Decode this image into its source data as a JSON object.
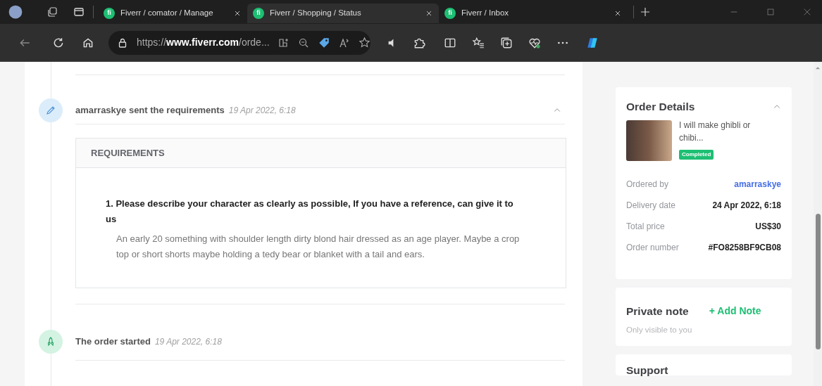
{
  "browser": {
    "tabs": [
      {
        "logo": "fi",
        "title": "Fiverr / comator / Manage",
        "selected": false
      },
      {
        "logo": "fi",
        "title": "Fiverr / Shopping / Status",
        "selected": true
      },
      {
        "logo": "fi",
        "title": "Fiverr / Inbox",
        "selected": false
      }
    ],
    "address": "https://**www.fiverr.com**/orde..."
  },
  "timeline": [
    {
      "kind": "requirements",
      "title": "amarraskye sent the requirements",
      "time": "19 Apr 2022, 6:18",
      "expanded": true,
      "panel": {
        "title": "REQUIREMENTS",
        "items": [
          {
            "question": "1. Please describe your character as clearly as possible, If you have a reference, can give it to us",
            "answer": "An early 20 something with shoulder length dirty blond hair dressed as an age player. Maybe a crop top or short shorts maybe holding a tedy bear or blanket with a tail and ears."
          }
        ]
      }
    },
    {
      "kind": "started",
      "title": "The order started",
      "time": "19 Apr 2022, 6:18"
    }
  ],
  "sidebar": {
    "order_details": {
      "title": "Order Details",
      "expanded": true,
      "gig_title": "I will make ghibli or chibi...",
      "status": "Completed",
      "rows": [
        {
          "label": "Ordered by",
          "value": "amarraskye",
          "kind": "link"
        },
        {
          "label": "Delivery date",
          "value": "24 Apr 2022, 6:18",
          "kind": "text"
        },
        {
          "label": "Total price",
          "value": "US$30",
          "kind": "text"
        },
        {
          "label": "Order number",
          "value": "#FO8258BF9CB08",
          "kind": "text"
        }
      ]
    },
    "private_note": {
      "title": "Private note",
      "action": "+ Add Note",
      "hint": "Only visible to you"
    },
    "support": {
      "title": "Support"
    }
  }
}
